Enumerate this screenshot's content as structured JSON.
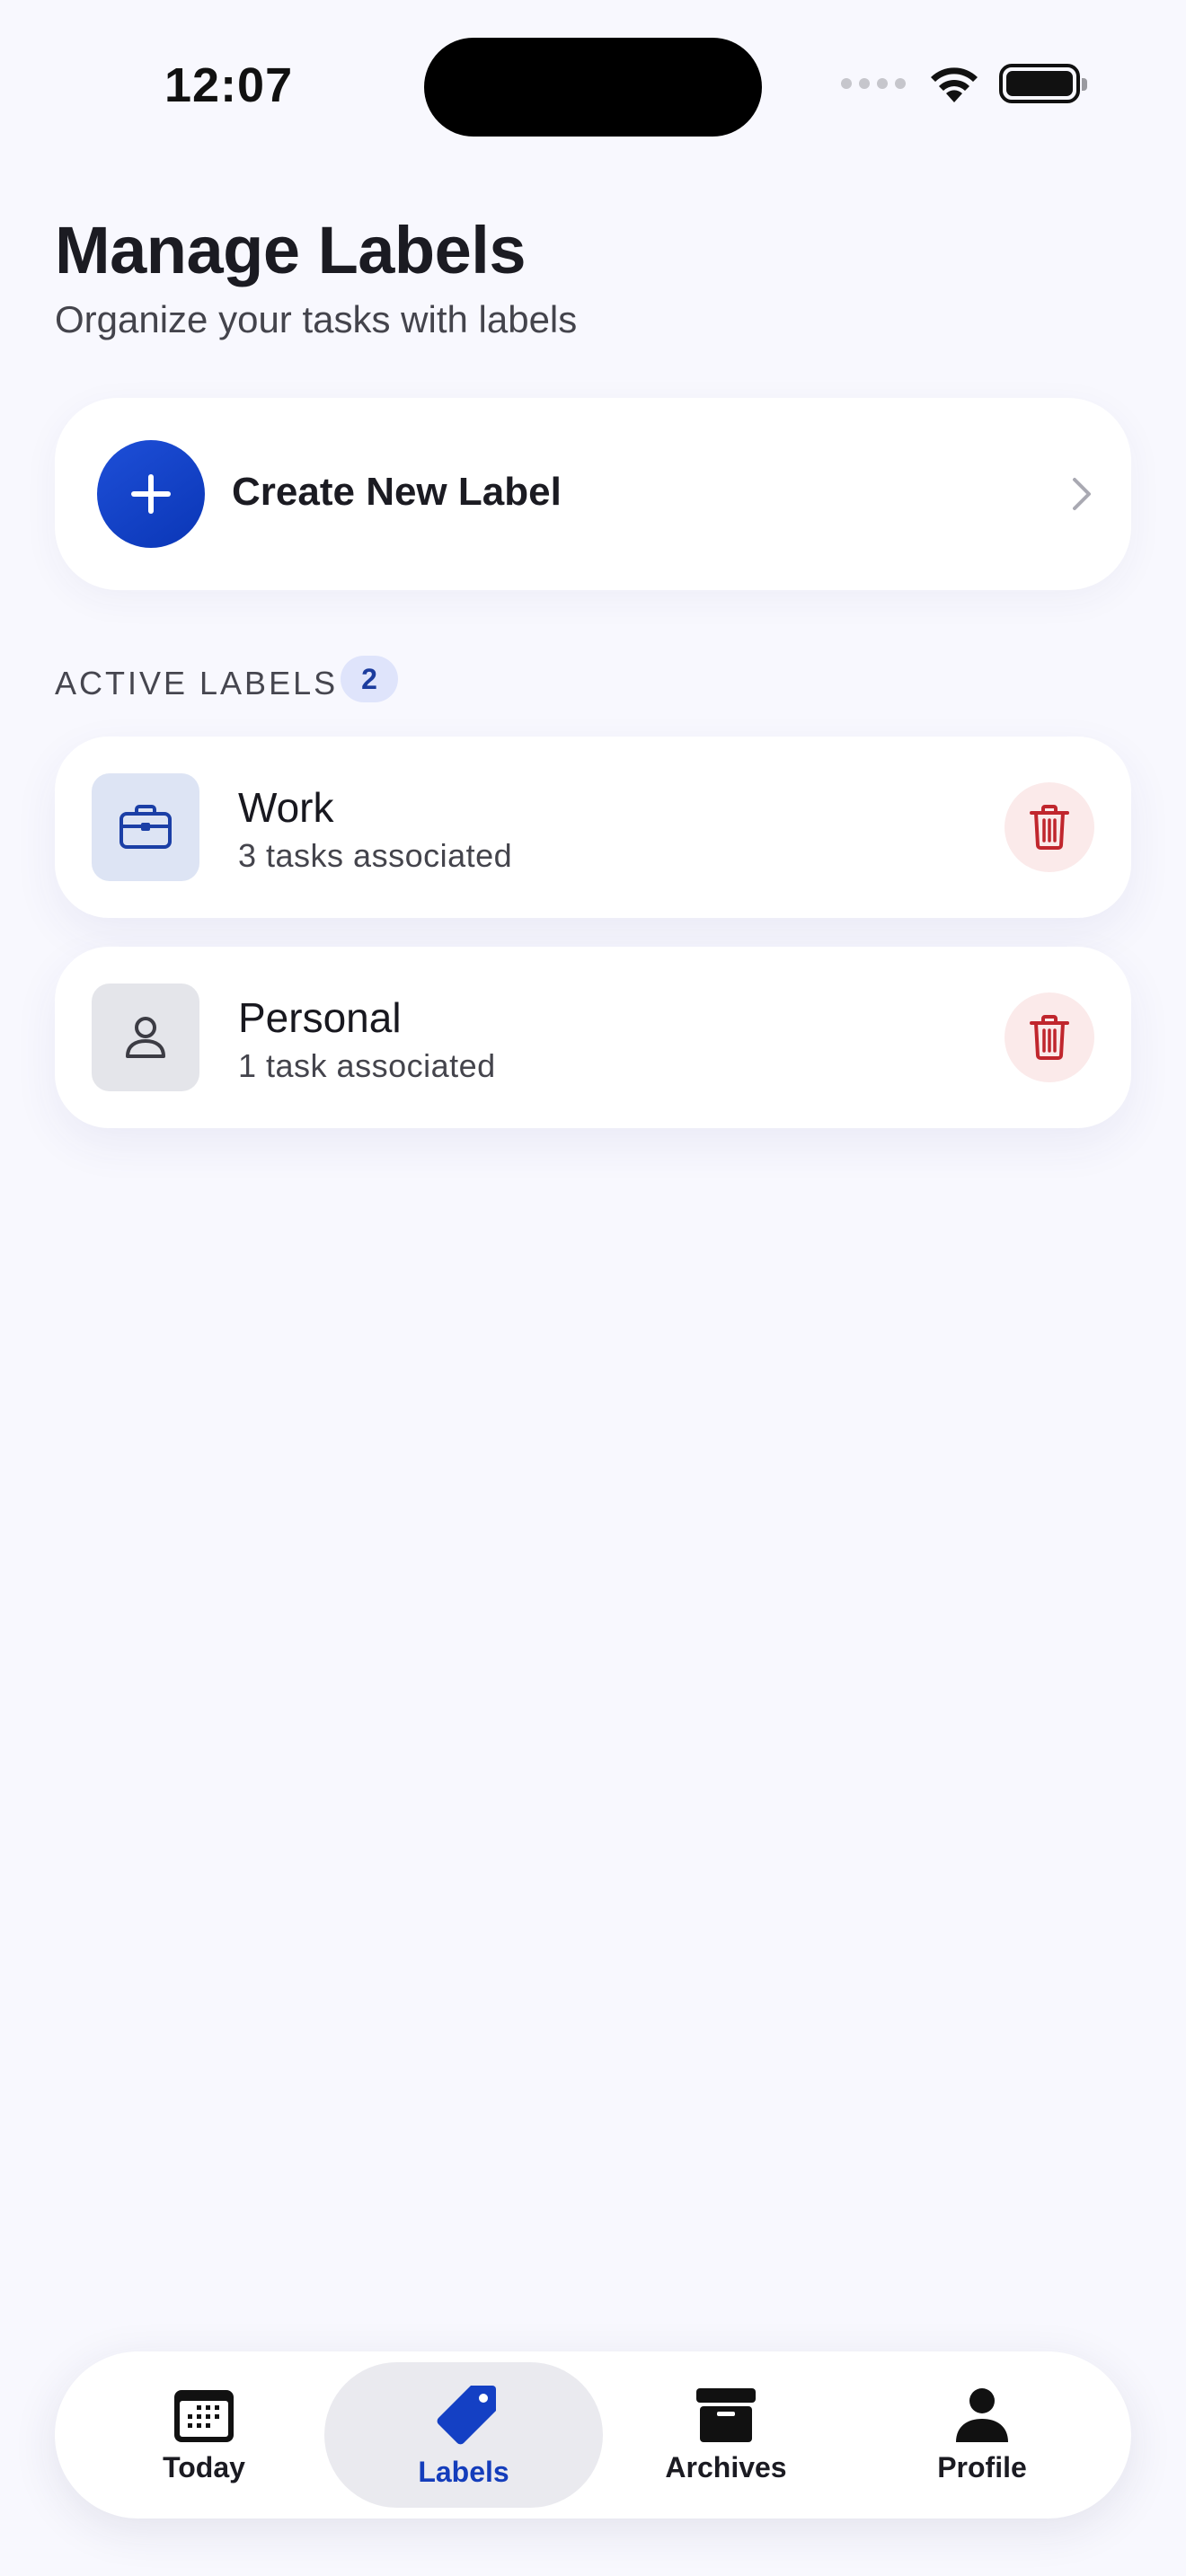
{
  "status": {
    "time": "12:07"
  },
  "header": {
    "title": "Manage Labels",
    "subtitle": "Organize your tasks with labels"
  },
  "create": {
    "label": "Create New Label",
    "icon": "plus-icon",
    "chevron": "chevron-right-icon"
  },
  "section": {
    "title": "ACTIVE LABELS",
    "count": "2"
  },
  "labels": [
    {
      "name": "Work",
      "meta": "3 tasks associated",
      "icon": "briefcase-icon",
      "icon_bg": "#dde4f4",
      "icon_color": "#1b3fa6"
    },
    {
      "name": "Personal",
      "meta": "1 task associated",
      "icon": "person-icon",
      "icon_bg": "#e4e5ea",
      "icon_color": "#3c3c44"
    }
  ],
  "tabs": [
    {
      "label": "Today",
      "icon": "calendar-icon",
      "active": false
    },
    {
      "label": "Labels",
      "icon": "tag-icon",
      "active": true
    },
    {
      "label": "Archives",
      "icon": "archive-box-icon",
      "active": false
    },
    {
      "label": "Profile",
      "icon": "person-fill-icon",
      "active": false
    }
  ],
  "colors": {
    "accent": "#1440c4",
    "danger": "#c0262d",
    "danger_bg": "#fbeaea",
    "background": "#f8f8fe"
  }
}
